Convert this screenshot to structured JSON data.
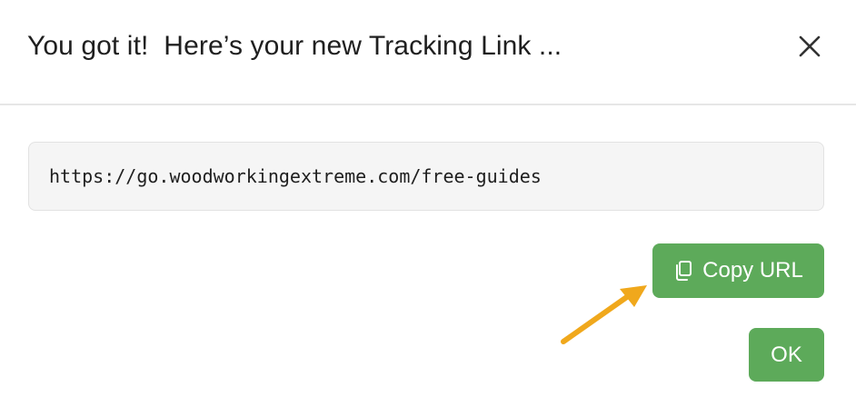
{
  "dialog": {
    "title": "You got it!  Here’s your new Tracking Link ...",
    "close_icon": "close-x-icon",
    "tracking_url": "https://go.woodworkingextreme.com/free-guides",
    "copy_button_label": "Copy URL",
    "copy_icon": "copy-icon",
    "ok_button_label": "OK"
  },
  "colors": {
    "button_green": "#5daa5a",
    "annotation_arrow": "#f0a81c"
  }
}
